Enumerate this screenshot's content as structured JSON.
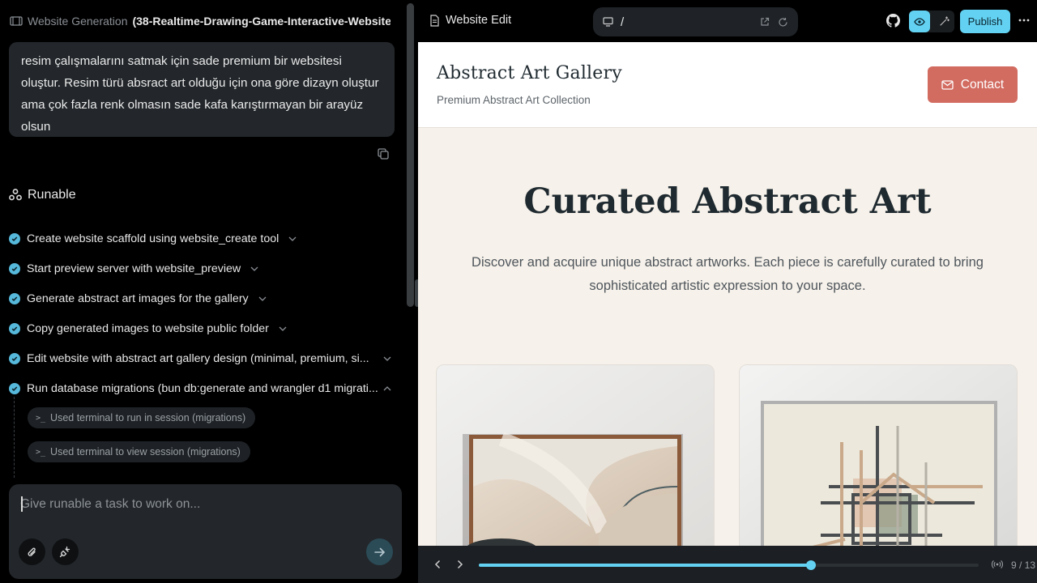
{
  "header": {
    "section_label": "Website Generation",
    "project_name": "(38-Realtime-Drawing-Game-Interactive-Website-..."
  },
  "user_message": "resim çalışmalarını satmak için sade premium bir websitesi oluştur. Resim türü absract art olduğu için ona göre dizayn oluştur ama çok fazla renk olmasın sade kafa karıştırmayan bir arayüz olsun",
  "assistant": {
    "name": "Runable"
  },
  "tasks": [
    {
      "label": "Create website scaffold using website_create tool",
      "status": "done",
      "expanded": false
    },
    {
      "label": "Start preview server with website_preview",
      "status": "done",
      "expanded": false
    },
    {
      "label": "Generate abstract art images for the gallery",
      "status": "done",
      "expanded": false
    },
    {
      "label": "Copy generated images to website public folder",
      "status": "done",
      "expanded": false
    },
    {
      "label": "Edit website with abstract art gallery design (minimal, premium, si...",
      "status": "done",
      "expanded": false
    },
    {
      "label": "Run database migrations (bun db:generate and wrangler d1 migrati...",
      "status": "done",
      "expanded": true
    }
  ],
  "subitems": [
    {
      "label": "Used terminal to run in session (migrations)"
    },
    {
      "label": "Used terminal to view session (migrations)"
    }
  ],
  "composer": {
    "placeholder": "Give runable a task to work on..."
  },
  "preview": {
    "title": "Website Edit",
    "url_path": "/",
    "publish_label": "Publish",
    "step_current": 9,
    "step_total": 13,
    "step_text": "9 / 13",
    "progress_fraction": 0.665
  },
  "site": {
    "title": "Abstract Art Gallery",
    "subtitle": "Premium Abstract Art Collection",
    "contact_label": "Contact",
    "hero_title": "Curated Abstract Art",
    "hero_subtitle": "Discover and acquire unique abstract artworks. Each piece is carefully curated to bring sophisticated artistic expression to your space."
  },
  "colors": {
    "accent": "#63d2f2",
    "check": "#56b8da",
    "contact_button": "#d26b60",
    "site_background": "#f6f1ea"
  },
  "icons": [
    "film-icon",
    "copy-icon",
    "runable-logo-icon",
    "check-icon",
    "chevron-down-icon",
    "chevron-up-icon",
    "terminal-icon",
    "paperclip-icon",
    "plug-icon",
    "arrow-right-icon",
    "document-icon",
    "monitor-icon",
    "external-link-icon",
    "refresh-icon",
    "github-icon",
    "eye-icon",
    "magic-wand-icon",
    "more-icon",
    "mail-icon",
    "chevron-left-icon",
    "chevron-right-icon",
    "broadcast-icon"
  ]
}
